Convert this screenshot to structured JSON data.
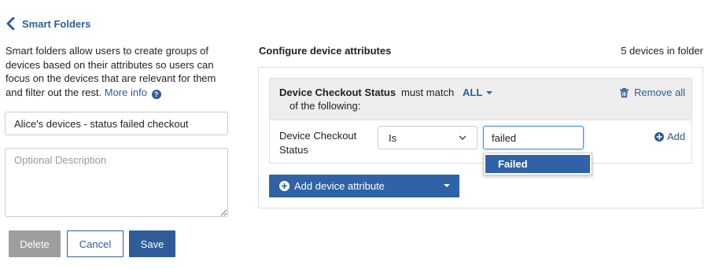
{
  "header": {
    "back_label": "Smart Folders",
    "back_icon": "chevron-left-icon"
  },
  "intro": {
    "text": "Smart folders allow users to create groups of devices based on their attributes so users can focus on the devices that are relevant for them and filter out the rest.",
    "link": "More info",
    "help_icon": "question-circle-icon"
  },
  "form": {
    "name_value": "Alice's devices - status failed checkout",
    "description_placeholder": "Optional Description",
    "delete_label": "Delete",
    "cancel_label": "Cancel",
    "save_label": "Save"
  },
  "config": {
    "title": "Configure device attributes",
    "device_count": "5 devices in folder",
    "rule": {
      "attribute": "Device Checkout Status",
      "must_match": "must match",
      "match_mode": "ALL",
      "of_following": "of the following:",
      "remove_all": "Remove all",
      "condition": {
        "label": "Device Checkout Status",
        "operator": "Is",
        "value": "failed",
        "add_label": "Add",
        "suggestion": "Failed"
      }
    },
    "add_attribute_label": "Add device attribute"
  },
  "colors": {
    "accent": "#2f5d99",
    "button_primary": "#2f62a6",
    "button_disabled": "#9e9e9e"
  }
}
